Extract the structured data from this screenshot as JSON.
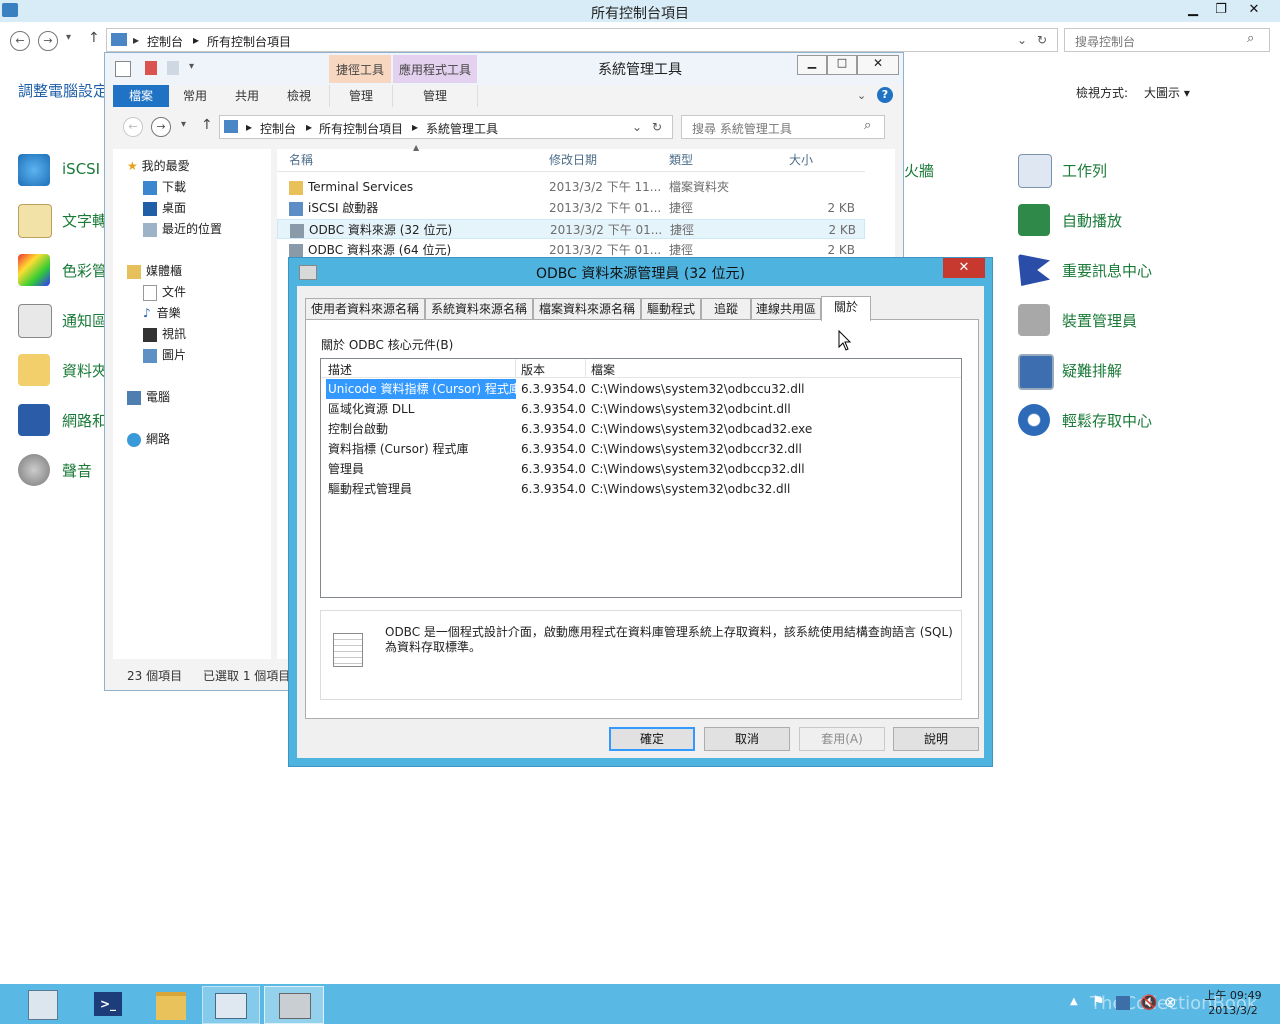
{
  "control_panel": {
    "title": "所有控制台項目",
    "crumbs": [
      "控制台",
      "所有控制台項目"
    ],
    "search_placeholder": "搜尋控制台",
    "heading": "調整電腦設定",
    "view_label": "檢視方式:",
    "view_value": "大圖示",
    "left_items": [
      "iSCSI",
      "文字轉",
      "色彩管",
      "通知區",
      "資料夾",
      "網路和",
      "聲音"
    ],
    "mid_items": [
      "火牆"
    ],
    "right_items": [
      "工作列",
      "自動播放",
      "重要訊息中心",
      "裝置管理員",
      "疑難排解",
      "輕鬆存取中心"
    ]
  },
  "explorer": {
    "title": "系統管理工具",
    "context_tabs": [
      "捷徑工具",
      "應用程式工具"
    ],
    "ribbon_tabs": [
      "檔案",
      "常用",
      "共用",
      "檢視",
      "管理",
      "管理"
    ],
    "crumbs": [
      "控制台",
      "所有控制台項目",
      "系統管理工具"
    ],
    "search_placeholder": "搜尋 系統管理工具",
    "nav": {
      "favorites": "我的最愛",
      "fav_items": [
        "下載",
        "桌面",
        "最近的位置"
      ],
      "libraries": "媒體櫃",
      "lib_items": [
        "文件",
        "音樂",
        "視訊",
        "圖片"
      ],
      "computer": "電腦",
      "network": "網路"
    },
    "columns": [
      "名稱",
      "修改日期",
      "類型",
      "大小"
    ],
    "files": [
      {
        "name": "Terminal Services",
        "date": "2013/3/2 下午 11...",
        "type": "檔案資料夾",
        "size": ""
      },
      {
        "name": "iSCSI 啟動器",
        "date": "2013/3/2 下午 01...",
        "type": "捷徑",
        "size": "2 KB"
      },
      {
        "name": "ODBC 資料來源 (32 位元)",
        "date": "2013/3/2 下午 01...",
        "type": "捷徑",
        "size": "2 KB"
      },
      {
        "name": "ODBC 資料來源 (64 位元)",
        "date": "2013/3/2 下午 01...",
        "type": "捷徑",
        "size": "2 KB"
      }
    ],
    "status_count": "23 個項目",
    "status_selected": "已選取 1 個項目"
  },
  "dialog": {
    "title": "ODBC 資料來源管理員 (32 位元)",
    "tabs": [
      "使用者資料來源名稱",
      "系統資料來源名稱",
      "檔案資料來源名稱",
      "驅動程式",
      "追蹤",
      "連線共用區",
      "關於"
    ],
    "section_label": "關於 ODBC 核心元件(B)",
    "grid_columns": [
      "描述",
      "版本",
      "檔案"
    ],
    "components": [
      {
        "desc": "Unicode 資料指標 (Cursor) 程式庫",
        "version": "6.3.9354.0",
        "file": "C:\\Windows\\system32\\odbccu32.dll"
      },
      {
        "desc": "區域化資源 DLL",
        "version": "6.3.9354.0",
        "file": "C:\\Windows\\system32\\odbcint.dll"
      },
      {
        "desc": "控制台啟動",
        "version": "6.3.9354.0",
        "file": "C:\\Windows\\system32\\odbcad32.exe"
      },
      {
        "desc": "資料指標 (Cursor) 程式庫",
        "version": "6.3.9354.0",
        "file": "C:\\Windows\\system32\\odbccr32.dll"
      },
      {
        "desc": "管理員",
        "version": "6.3.9354.0",
        "file": "C:\\Windows\\system32\\odbccp32.dll"
      },
      {
        "desc": "驅動程式管理員",
        "version": "6.3.9354.0",
        "file": "C:\\Windows\\system32\\odbc32.dll"
      }
    ],
    "info_text": "ODBC 是一個程式設計介面，啟動應用程式在資料庫管理系統上存取資料，該系統使用結構查詢語言 (SQL) 為資料存取標準。",
    "buttons": {
      "ok": "確定",
      "cancel": "取消",
      "apply": "套用(A)",
      "help": "說明"
    }
  },
  "taskbar": {
    "time": "上午 09:49",
    "date": "2013/3/2",
    "watermark": "TheCollectionBook"
  },
  "colors": {
    "accent": "#5ab8e4",
    "link_green": "#1f7a34",
    "selection": "#3399ff"
  }
}
